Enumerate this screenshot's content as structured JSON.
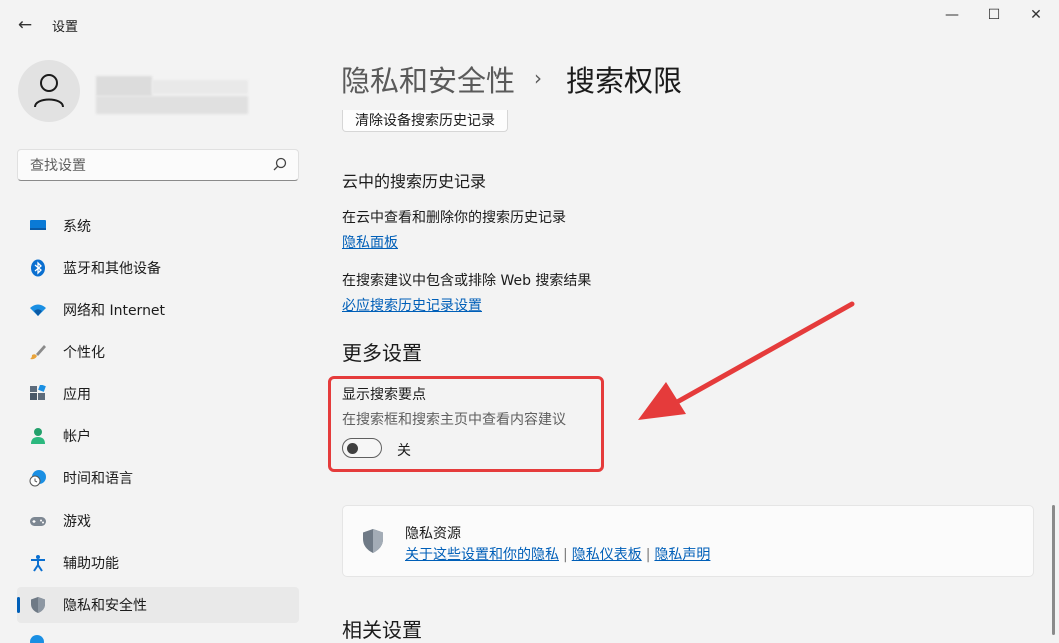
{
  "window": {
    "title": "设置",
    "controls": {
      "minimize": "—",
      "maximize": "☐",
      "close": "✕"
    }
  },
  "search": {
    "placeholder": "查找设置"
  },
  "sidebar": {
    "items": [
      {
        "label": "系统",
        "icon": "monitor-icon"
      },
      {
        "label": "蓝牙和其他设备",
        "icon": "bluetooth-icon"
      },
      {
        "label": "网络和 Internet",
        "icon": "wifi-icon"
      },
      {
        "label": "个性化",
        "icon": "brush-icon"
      },
      {
        "label": "应用",
        "icon": "apps-icon"
      },
      {
        "label": "帐户",
        "icon": "account-icon"
      },
      {
        "label": "时间和语言",
        "icon": "clock-globe-icon"
      },
      {
        "label": "游戏",
        "icon": "gamepad-icon"
      },
      {
        "label": "辅助功能",
        "icon": "accessibility-icon"
      },
      {
        "label": "隐私和安全性",
        "icon": "shield-icon",
        "active": true
      }
    ]
  },
  "breadcrumb": {
    "parent": "隐私和安全性",
    "separator": "›",
    "current": "搜索权限"
  },
  "main": {
    "clear_history_button": "清除设备搜索历史记录",
    "cloud_history": {
      "heading": "云中的搜索历史记录",
      "view_delete_text": "在云中查看和删除你的搜索历史记录",
      "privacy_dashboard_link": "隐私面板",
      "include_exclude_text": "在搜索建议中包含或排除 Web 搜索结果",
      "bing_settings_link": "必应搜索历史记录设置"
    },
    "more_settings": {
      "heading": "更多设置",
      "highlights_title": "显示搜索要点",
      "highlights_desc": "在搜索框和搜索主页中查看内容建议",
      "toggle_state": "关",
      "toggle_on": false
    },
    "privacy_resources": {
      "title": "隐私资源",
      "links": [
        "关于这些设置和你的隐私",
        "隐私仪表板",
        "隐私声明"
      ],
      "separator": "|"
    },
    "related_heading": "相关设置"
  },
  "colors": {
    "accent": "#005fb8",
    "annotation": "#e53b3b",
    "background": "#f3f3f3"
  }
}
